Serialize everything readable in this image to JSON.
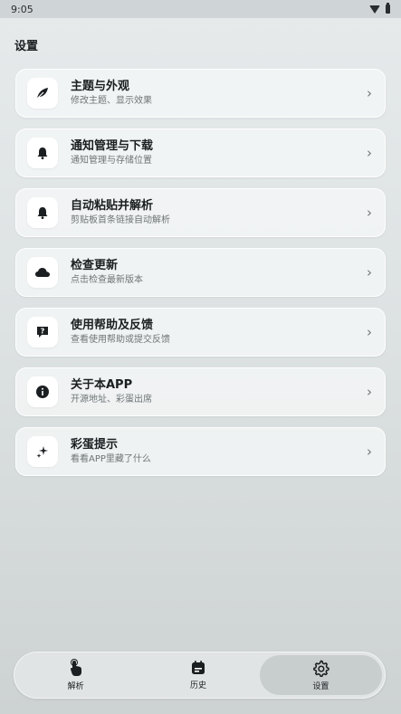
{
  "status_bar": {
    "time": "9:05"
  },
  "page": {
    "title": "设置"
  },
  "menu": [
    {
      "title": "主题与外观",
      "subtitle": "修改主题、显示效果",
      "icon": "leaf-icon"
    },
    {
      "title": "通知管理与下载",
      "subtitle": "通知管理与存储位置",
      "icon": "bell-icon"
    },
    {
      "title": "自动粘贴并解析",
      "subtitle": "剪贴板首条链接自动解析",
      "icon": "bell-icon"
    },
    {
      "title": "检查更新",
      "subtitle": "点击检查最新版本",
      "icon": "cloud-icon"
    },
    {
      "title": "使用帮助及反馈",
      "subtitle": "查看使用帮助或提交反馈",
      "icon": "help-icon"
    },
    {
      "title": "关于本APP",
      "subtitle": "开源地址、彩蛋出席",
      "icon": "info-icon"
    },
    {
      "title": "彩蛋提示",
      "subtitle": "看看APP里藏了什么",
      "icon": "sparkle-icon"
    }
  ],
  "bottom_nav": [
    {
      "label": "解析",
      "icon": "tap-icon",
      "active": false
    },
    {
      "label": "历史",
      "icon": "calendar-icon",
      "active": false
    },
    {
      "label": "设置",
      "icon": "gear-icon",
      "active": true
    }
  ]
}
